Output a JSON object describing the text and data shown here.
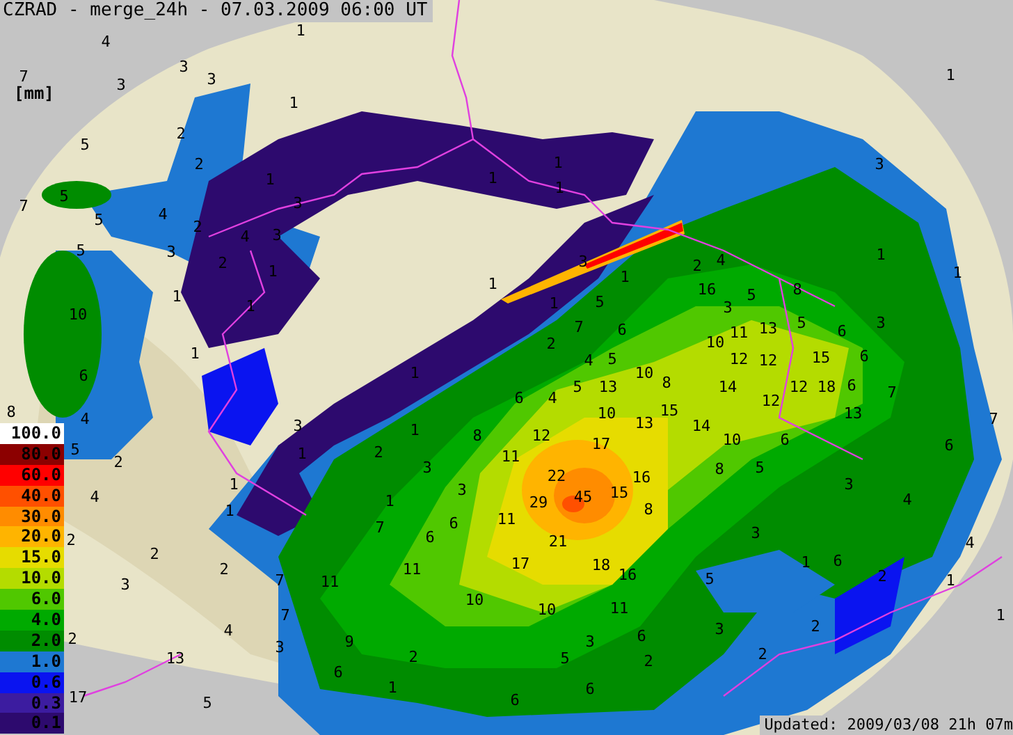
{
  "title": "CZRAD - merge_24h - 07.03.2009 06:00 UT",
  "unit": "[mm]",
  "legend": [
    {
      "value": "100.0",
      "color": "#ffffff"
    },
    {
      "value": "80.0",
      "color": "#8c0000"
    },
    {
      "value": "60.0",
      "color": "#ff0000"
    },
    {
      "value": "40.0",
      "color": "#ff5000"
    },
    {
      "value": "30.0",
      "color": "#ff8c00"
    },
    {
      "value": "20.0",
      "color": "#ffb400"
    },
    {
      "value": "15.0",
      "color": "#e6dc00"
    },
    {
      "value": "10.0",
      "color": "#b4dc00"
    },
    {
      "value": "6.0",
      "color": "#50c800"
    },
    {
      "value": "4.0",
      "color": "#00aa00"
    },
    {
      "value": "2.0",
      "color": "#008c00"
    },
    {
      "value": "1.0",
      "color": "#1e78d2"
    },
    {
      "value": "0.6",
      "color": "#0a14f0"
    },
    {
      "value": "0.3",
      "color": "#3c1ca0"
    },
    {
      "value": "0.1",
      "color": "#2d0a6e"
    }
  ],
  "station_values": [
    "4",
    "1",
    "7",
    "3",
    "3",
    "3",
    "1",
    "2",
    "2",
    "5",
    "1",
    "7",
    "5",
    "3",
    "5",
    "4",
    "2",
    "4",
    "3",
    "5",
    "3",
    "2",
    "1",
    "1",
    "10",
    "1",
    "1",
    "1",
    "1",
    "1",
    "3",
    "1",
    "1",
    "1",
    "5",
    "2",
    "7",
    "6",
    "4",
    "5",
    "1",
    "3",
    "2",
    "4",
    "1",
    "1",
    "16",
    "5",
    "8",
    "3",
    "11",
    "13",
    "5",
    "6",
    "3",
    "10",
    "12",
    "12",
    "15",
    "6",
    "6",
    "8",
    "4",
    "5",
    "2",
    "4",
    "1",
    "1",
    "3",
    "1",
    "2",
    "2",
    "3",
    "2",
    "7",
    "11",
    "7",
    "2",
    "4",
    "13",
    "3",
    "6",
    "17",
    "5",
    "1",
    "6",
    "4",
    "5",
    "13",
    "10",
    "8",
    "10",
    "15",
    "1",
    "2",
    "8",
    "12",
    "17",
    "13",
    "3",
    "11",
    "22",
    "16",
    "1",
    "3",
    "29",
    "45",
    "15",
    "7",
    "6",
    "11",
    "8",
    "6",
    "21",
    "11",
    "17",
    "18",
    "16",
    "10",
    "10",
    "11",
    "9",
    "3",
    "6",
    "2",
    "5",
    "2",
    "1",
    "6",
    "6",
    "14",
    "12",
    "12",
    "18",
    "6",
    "7",
    "13",
    "14",
    "10",
    "6",
    "6",
    "8",
    "5",
    "3",
    "4",
    "3",
    "4",
    "5",
    "1",
    "6",
    "2",
    "1",
    "3",
    "2",
    "2",
    "1",
    "7"
  ],
  "updated": "Updated: 2009/03/08 21h 07m"
}
